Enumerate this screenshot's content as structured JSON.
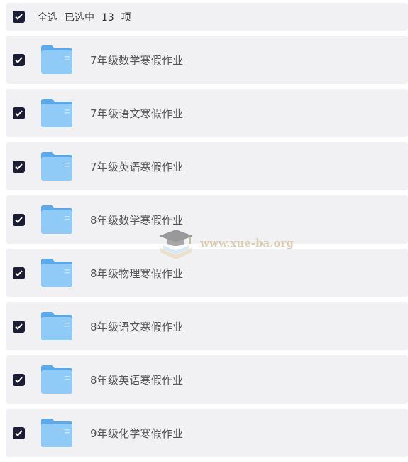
{
  "header": {
    "select_all": "全选",
    "selected_prefix": "已选中",
    "selected_count": "13",
    "selected_suffix": "项"
  },
  "items": [
    {
      "name": "7年级数学寒假作业"
    },
    {
      "name": "7年级语文寒假作业"
    },
    {
      "name": "7年级英语寒假作业"
    },
    {
      "name": "8年级数学寒假作业"
    },
    {
      "name": "8年级物理寒假作业"
    },
    {
      "name": "8年级语文寒假作业"
    },
    {
      "name": "8年级英语寒假作业"
    },
    {
      "name": "9年级化学寒假作业"
    }
  ],
  "watermark": {
    "text": "www.xue-ba.org"
  },
  "icons": {
    "checkbox": "checkbox-checked-icon",
    "folder": "folder-icon",
    "logo": "graduation-cap-icon"
  },
  "colors": {
    "checkbox": "#1a1d33",
    "row_bg": "#f1f1f4",
    "folder": "#7cc0f3"
  }
}
